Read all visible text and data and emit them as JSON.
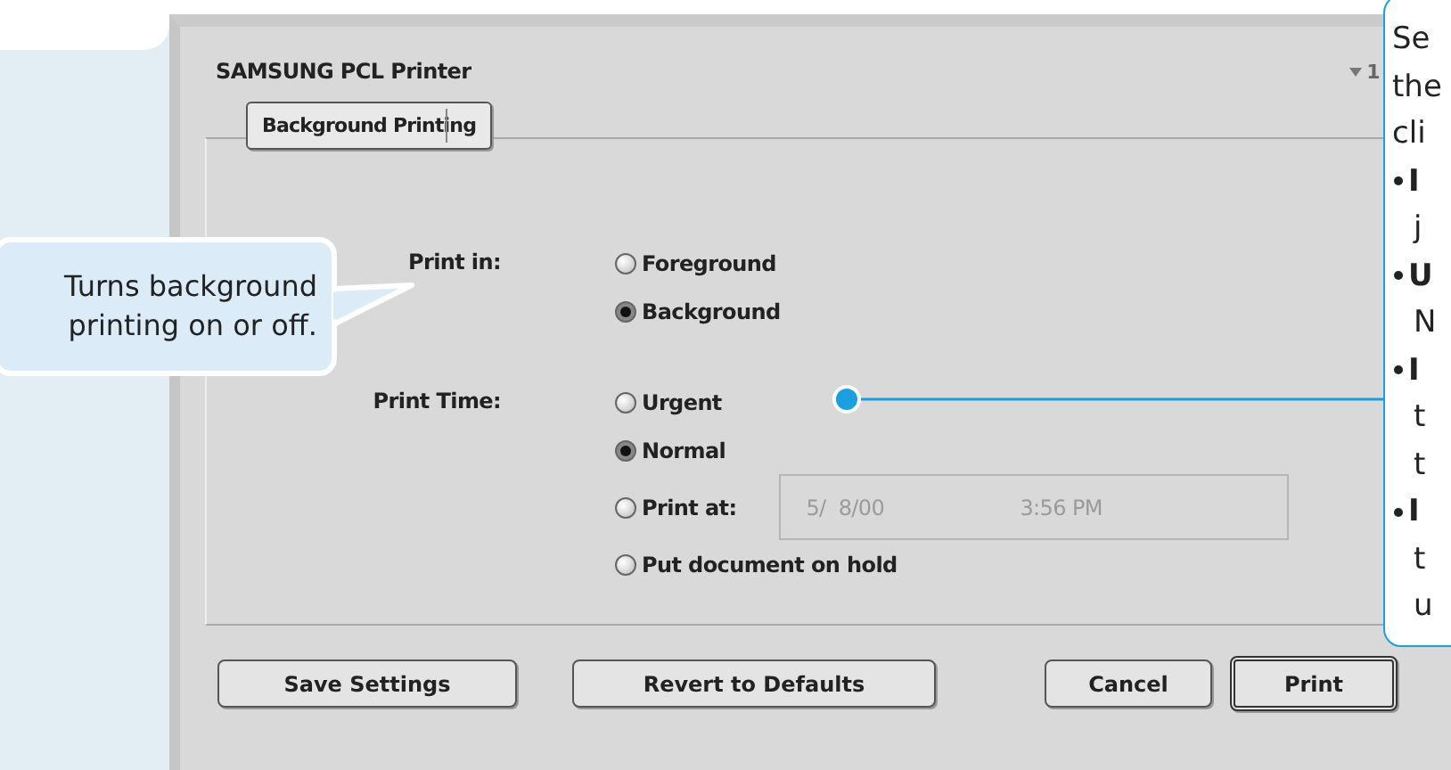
{
  "dialog": {
    "title": "SAMSUNG PCL Printer",
    "version": "1",
    "panel_menu": {
      "value": "Background Printing"
    },
    "groups": [
      {
        "label": "Print in:",
        "options": [
          {
            "label": "Foreground",
            "selected": false
          },
          {
            "label": "Background",
            "selected": true
          }
        ]
      },
      {
        "label": "Print Time:",
        "options": [
          {
            "label": "Urgent",
            "selected": false
          },
          {
            "label": "Normal",
            "selected": true
          },
          {
            "label": "Print at:",
            "selected": false,
            "kind": "datetime",
            "date": "5/  8/00",
            "time": "3:56 PM",
            "disabled": true
          },
          {
            "label": "Put document on hold",
            "selected": false
          }
        ]
      }
    ],
    "buttons": [
      {
        "label": "Save Settings",
        "default": false
      },
      {
        "label": "Revert to Defaults",
        "default": false
      },
      {
        "label": "Cancel",
        "default": false
      },
      {
        "label": "Print",
        "default": true
      }
    ]
  },
  "left_callout": {
    "text": "Turns background printing on or off."
  },
  "right_callout": {
    "lines": [
      {
        "bullet": false,
        "text": "Se"
      },
      {
        "bullet": false,
        "text": "the"
      },
      {
        "bullet": false,
        "text": "cli"
      },
      {
        "bullet": true,
        "text": "**I**"
      },
      {
        "bullet": false,
        "text": "j"
      },
      {
        "bullet": true,
        "text": "**U**"
      },
      {
        "bullet": false,
        "text": "N"
      },
      {
        "bullet": true,
        "text": "**I**"
      },
      {
        "bullet": false,
        "text": "t"
      },
      {
        "bullet": false,
        "text": "t"
      },
      {
        "bullet": true,
        "text": "**I**"
      },
      {
        "bullet": false,
        "text": "t"
      },
      {
        "bullet": false,
        "text": "u"
      }
    ]
  }
}
